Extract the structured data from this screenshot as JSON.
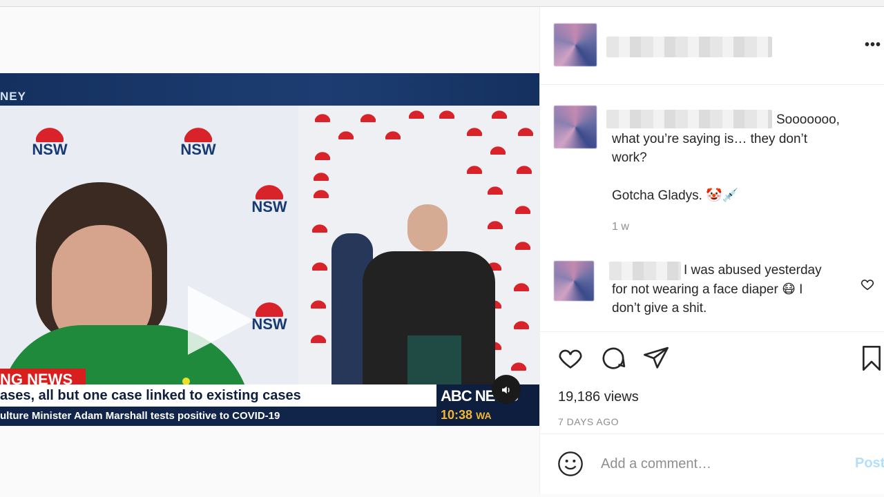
{
  "video": {
    "strip_text": "NEY",
    "nsw_word": "NSW",
    "breaking_label": "NG NEWS",
    "headline": "ases, all but one case linked to existing cases",
    "ticker": "ulture Minister Adam Marshall tests positive to COVID-19",
    "channel": "ABC NEWS",
    "time": "10:38",
    "timezone": "WA"
  },
  "header": {
    "more_label": "•••"
  },
  "comments": [
    {
      "line1": "Sooooooo,",
      "line2": "what you’re saying is… they don’t",
      "line3": "work?",
      "line4": "Gotcha Gladys. 🤡💉",
      "time": "1 w"
    },
    {
      "line1": "I was abused yesterday",
      "line2": "for not wearing a face diaper 😷 I",
      "line3": "don’t give a shit."
    }
  ],
  "stats": {
    "views": "19,186 views",
    "posted_ago": "7 DAYS AGO"
  },
  "add_comment": {
    "placeholder": "Add a comment…",
    "post_label": "Post"
  },
  "icons": {
    "like": "heart-icon",
    "comment": "comment-bubble-icon",
    "share": "paper-plane-icon",
    "save": "bookmark-icon",
    "emoji": "smiley-icon",
    "more": "more-dots-icon",
    "mute": "speaker-icon",
    "play": "play-icon"
  },
  "colors": {
    "accent_link": "#b2dffc",
    "muted_text": "#8e8e8e",
    "breaking_red": "#d91e1e",
    "abc_navy": "#0d1e3f"
  }
}
